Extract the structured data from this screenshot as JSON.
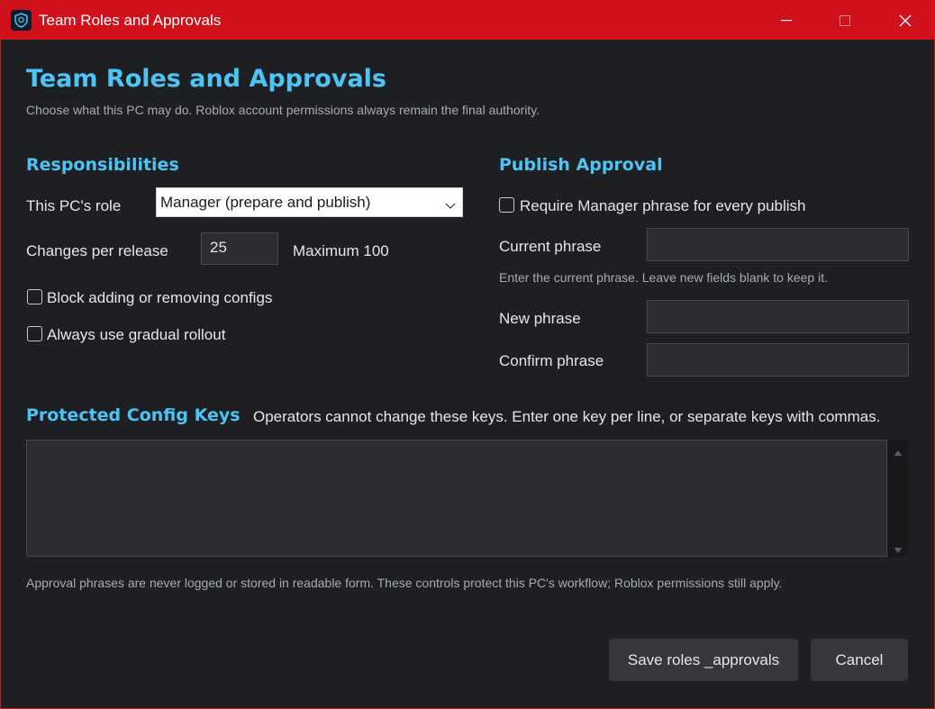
{
  "window": {
    "title": "Team Roles and Approvals",
    "titlebar_color": "#d0111b",
    "accent_color": "#4cc4f5"
  },
  "header": {
    "title": "Team Roles and Approvals",
    "subtitle": "Choose what this PC may do. Roblox account permissions always remain the final authority."
  },
  "responsibilities": {
    "heading": "Responsibilities",
    "role_label": "This PC's role",
    "role_value": "Manager (prepare and publish)",
    "changes_label": "Changes per release",
    "changes_value": "25",
    "changes_max": "Maximum 100",
    "block_configs_label": "Block adding or removing configs",
    "block_configs_checked": false,
    "gradual_rollout_label": "Always use gradual rollout",
    "gradual_rollout_checked": false
  },
  "publish_approval": {
    "heading": "Publish Approval",
    "require_phrase_label": "Require Manager phrase for every publish",
    "require_phrase_checked": false,
    "current_phrase_label": "Current phrase",
    "current_phrase_hint": "Enter the current phrase. Leave new fields blank to keep it.",
    "new_phrase_label": "New phrase",
    "confirm_phrase_label": "Confirm phrase"
  },
  "protected_keys": {
    "heading": "Protected Config Keys",
    "description": "Operators cannot change these keys. Enter one key per line, or separate keys with commas.",
    "value": ""
  },
  "footer": {
    "note": "Approval phrases are never logged or stored in readable form. These controls protect this PC's workflow; Roblox permissions still apply.",
    "save_label": "Save roles _approvals",
    "cancel_label": "Cancel"
  }
}
